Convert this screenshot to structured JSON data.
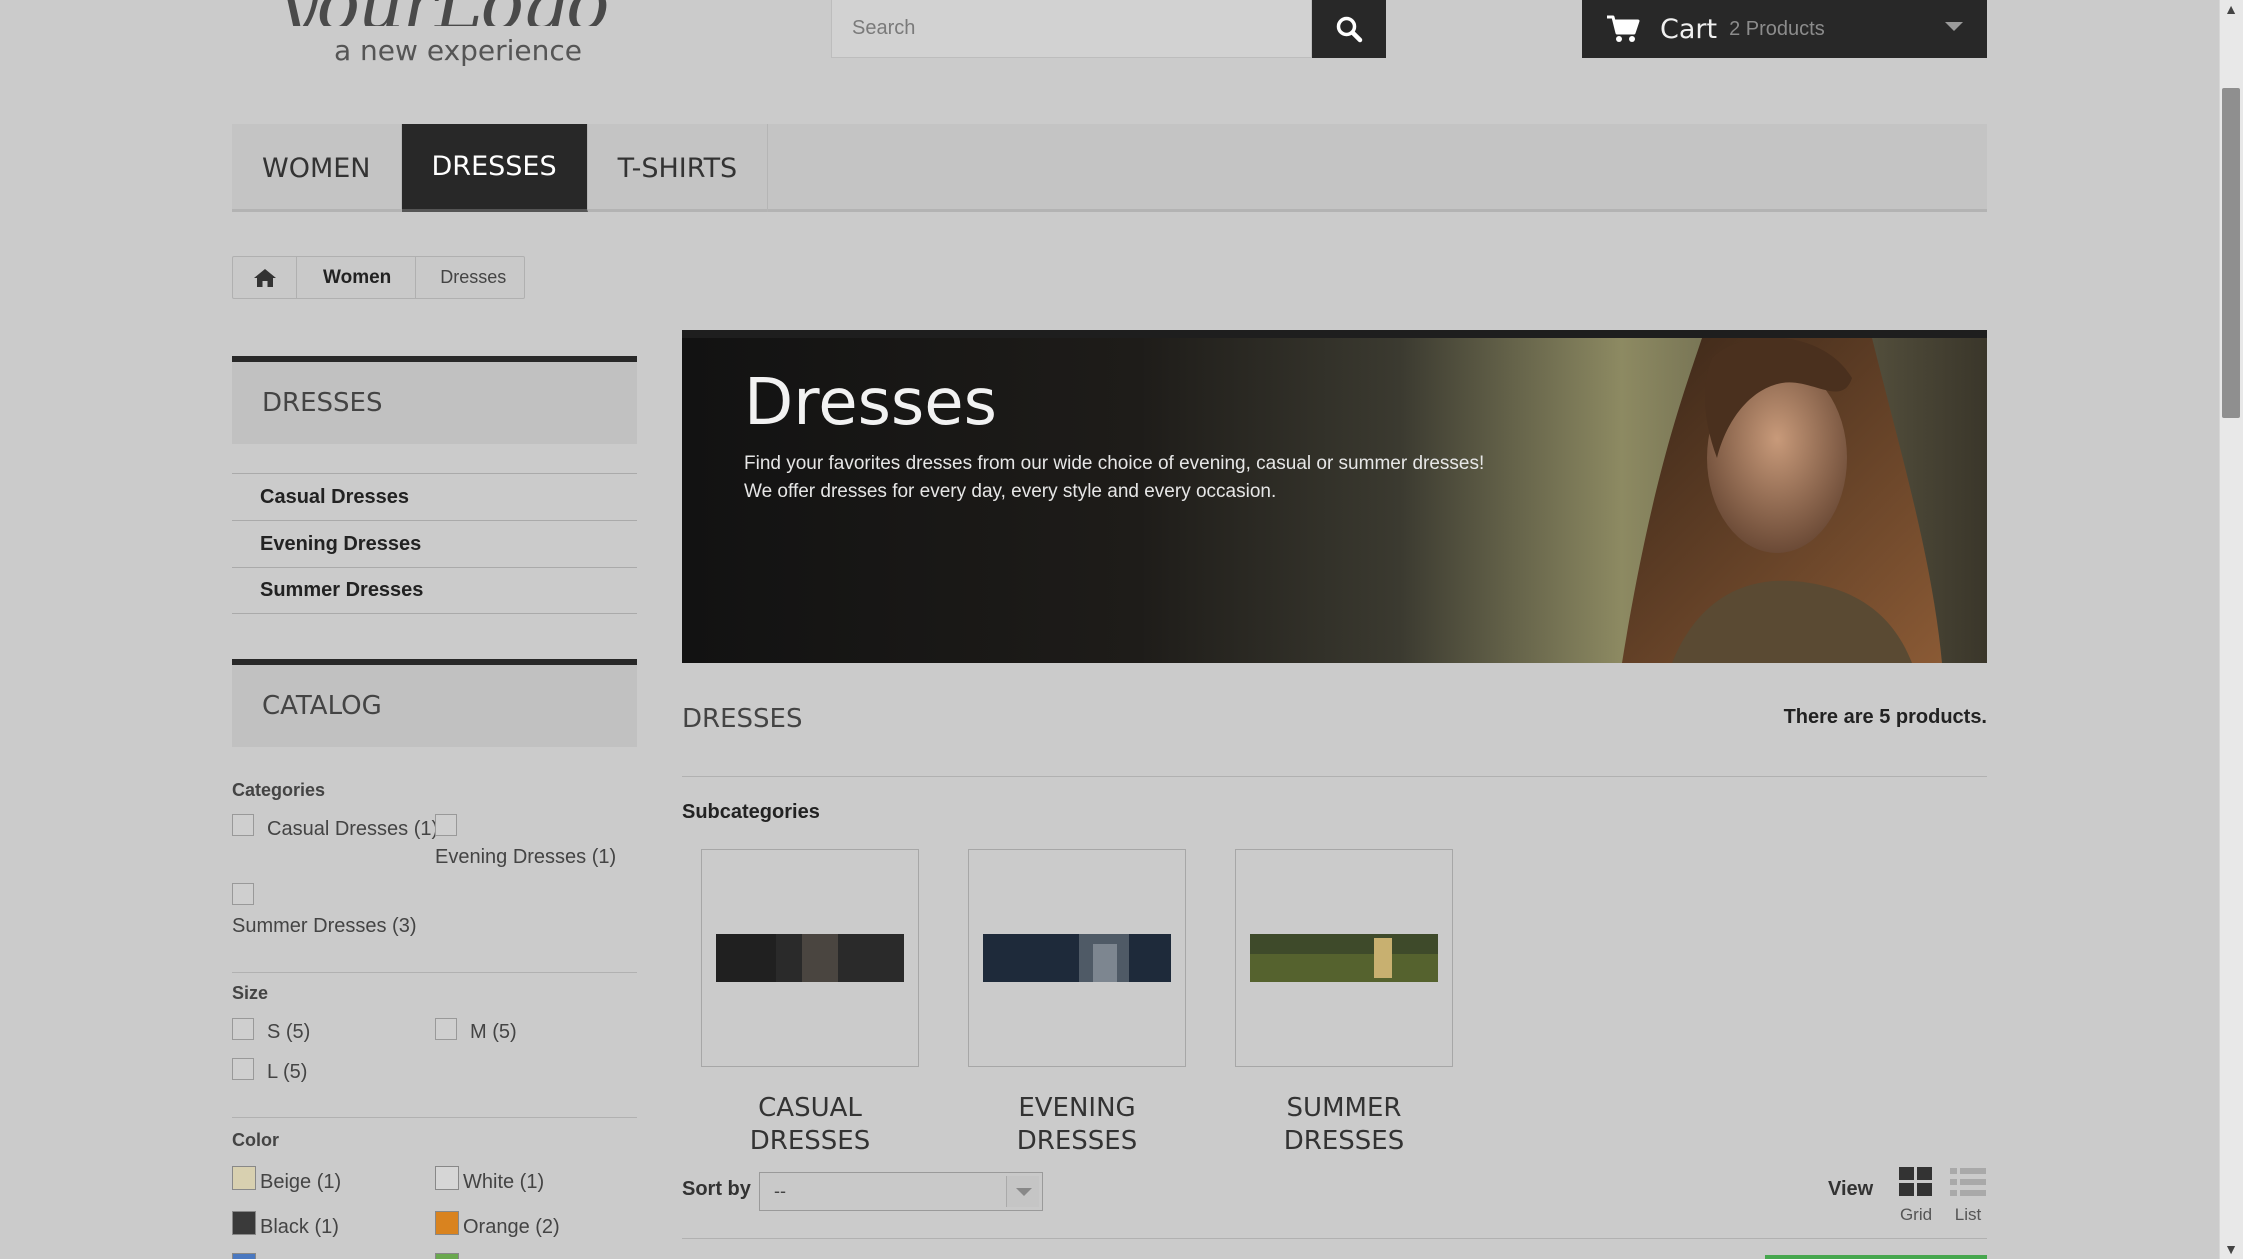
{
  "header": {
    "logo_text": "yourLogo",
    "logo_tagline": "a new experience",
    "search_placeholder": "Search",
    "cart_label": "Cart",
    "cart_count": "2 Products"
  },
  "topnav": [
    "WOMEN",
    "DRESSES",
    "T-SHIRTS"
  ],
  "breadcrumb": {
    "parent": "Women",
    "current": "Dresses"
  },
  "sidebar": {
    "dresses_title": "DRESSES",
    "dresses_items": [
      "Casual Dresses",
      "Evening Dresses",
      "Summer Dresses"
    ],
    "catalog_title": "CATALOG",
    "categories_head": "Categories",
    "categories": [
      "Casual Dresses (1)",
      "Evening Dresses (1)",
      "Summer Dresses (3)"
    ],
    "size_head": "Size",
    "sizes": [
      "S (5)",
      "M (5)",
      "L (5)"
    ],
    "color_head": "Color",
    "colors": [
      {
        "label": "Beige (1)",
        "hex": "#d8d0b0"
      },
      {
        "label": "White (1)",
        "hex": "#d6d6d6"
      },
      {
        "label": "Black (1)",
        "hex": "#3a3a3a"
      },
      {
        "label": "Orange (2)",
        "hex": "#d9831f"
      }
    ]
  },
  "banner": {
    "title": "Dresses",
    "line1": "Find your favorites dresses from our wide choice of evening, casual or summer dresses!",
    "line2": "We offer dresses for every day, every style and every occasion."
  },
  "listing": {
    "heading": "DRESSES",
    "count": "There are 5 products.",
    "subcategories_head": "Subcategories",
    "subcategories": [
      {
        "line1": "CASUAL",
        "line2": "DRESSES"
      },
      {
        "line1": "EVENING",
        "line2": "DRESSES"
      },
      {
        "line1": "SUMMER",
        "line2": "DRESSES"
      }
    ],
    "sort_label": "Sort by",
    "sort_value": "--",
    "view_label": "View",
    "view_grid": "Grid",
    "view_list": "List"
  }
}
